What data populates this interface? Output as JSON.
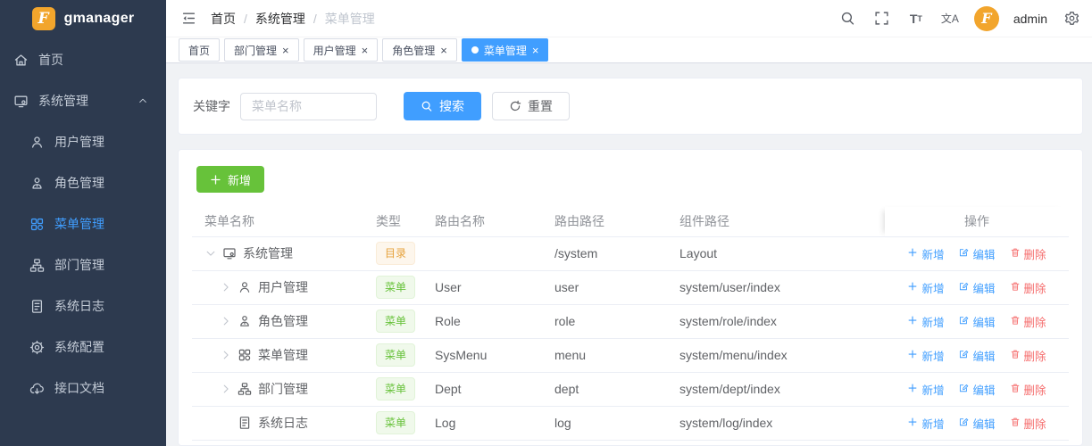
{
  "app": {
    "title": "gmanager",
    "logo_letter": "F"
  },
  "header": {
    "breadcrumb": [
      "首页",
      "系统管理",
      "菜单管理"
    ],
    "separator": "/",
    "font_size_glyph": "T",
    "translate_glyph": "文A",
    "user": "admin"
  },
  "tabbar": {
    "tabs": [
      {
        "label": "首页",
        "closable": false,
        "active": false
      },
      {
        "label": "部门管理",
        "closable": true,
        "active": false
      },
      {
        "label": "用户管理",
        "closable": true,
        "active": false
      },
      {
        "label": "角色管理",
        "closable": true,
        "active": false
      },
      {
        "label": "菜单管理",
        "closable": true,
        "active": true
      }
    ],
    "close_glyph": "×"
  },
  "sidebar": {
    "items": [
      {
        "label": "首页",
        "icon": "home-icon",
        "level": 0,
        "active": false,
        "arrow": ""
      },
      {
        "label": "系统管理",
        "icon": "system-icon",
        "level": 0,
        "active": false,
        "arrow": "up"
      },
      {
        "label": "用户管理",
        "icon": "user-icon",
        "level": 1,
        "active": false,
        "arrow": ""
      },
      {
        "label": "角色管理",
        "icon": "role-icon",
        "level": 1,
        "active": false,
        "arrow": ""
      },
      {
        "label": "菜单管理",
        "icon": "menu-icon",
        "level": 1,
        "active": true,
        "arrow": ""
      },
      {
        "label": "部门管理",
        "icon": "dept-icon",
        "level": 1,
        "active": false,
        "arrow": ""
      },
      {
        "label": "系统日志",
        "icon": "log-icon",
        "level": 1,
        "active": false,
        "arrow": ""
      },
      {
        "label": "系统配置",
        "icon": "config-icon",
        "level": 1,
        "active": false,
        "arrow": ""
      },
      {
        "label": "接口文档",
        "icon": "api-doc-icon",
        "level": 1,
        "active": false,
        "arrow": ""
      }
    ]
  },
  "search": {
    "label": "关键字",
    "placeholder": "菜单名称",
    "value": "",
    "search_btn": "搜索",
    "reset_btn": "重置"
  },
  "table": {
    "add_btn": "新增",
    "columns": [
      "菜单名称",
      "类型",
      "路由名称",
      "路由路径",
      "组件路径",
      "操作"
    ],
    "ops": [
      "新增",
      "编辑",
      "删除"
    ],
    "badge_styles": {
      "目录": {
        "color": "#e6a23c",
        "bg": "#fdf6ec",
        "border": "#faecd8"
      },
      "菜单": {
        "color": "#67c23a",
        "bg": "#f0f9eb",
        "border": "#e1f3d8"
      }
    },
    "rows": [
      {
        "name": "系统管理",
        "icon": "system-icon",
        "level": 0,
        "expand": "down",
        "type": "目录",
        "route_name": "",
        "route_path": "/system",
        "component": "Layout"
      },
      {
        "name": "用户管理",
        "icon": "user-icon",
        "level": 1,
        "expand": "right",
        "type": "菜单",
        "route_name": "User",
        "route_path": "user",
        "component": "system/user/index"
      },
      {
        "name": "角色管理",
        "icon": "role-icon",
        "level": 1,
        "expand": "right",
        "type": "菜单",
        "route_name": "Role",
        "route_path": "role",
        "component": "system/role/index"
      },
      {
        "name": "菜单管理",
        "icon": "menu-icon",
        "level": 1,
        "expand": "right",
        "type": "菜单",
        "route_name": "SysMenu",
        "route_path": "menu",
        "component": "system/menu/index"
      },
      {
        "name": "部门管理",
        "icon": "dept-icon",
        "level": 1,
        "expand": "right",
        "type": "菜单",
        "route_name": "Dept",
        "route_path": "dept",
        "component": "system/dept/index"
      },
      {
        "name": "系统日志",
        "icon": "log-icon",
        "level": 1,
        "expand": "none",
        "type": "菜单",
        "route_name": "Log",
        "route_path": "log",
        "component": "system/log/index"
      }
    ]
  },
  "colors": {
    "primary": "#409eff",
    "success": "#67c23a",
    "danger": "#f56c6c",
    "warning": "#e6a23c",
    "sidebar_bg": "#2d3a4f",
    "logo_orange": "#f2a52c"
  }
}
